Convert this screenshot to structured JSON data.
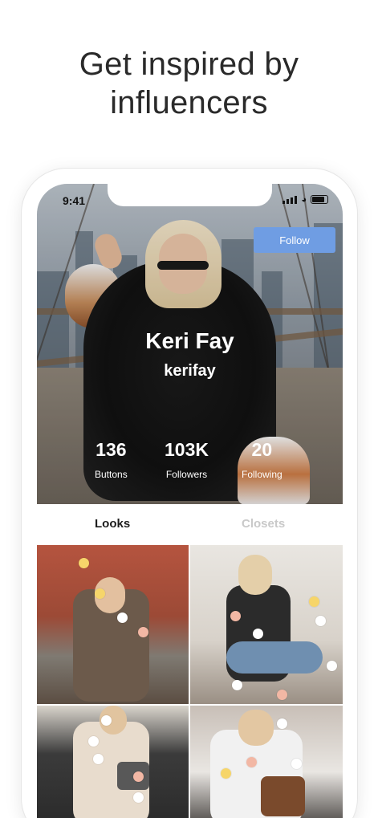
{
  "headline": "Get inspired by influencers",
  "status_bar": {
    "time": "9:41"
  },
  "profile": {
    "name": "Keri Fay",
    "handle": "kerifay",
    "follow_label": "Follow",
    "stats": [
      {
        "value": "136",
        "label": "Buttons"
      },
      {
        "value": "103K",
        "label": "Followers"
      },
      {
        "value": "20",
        "label": "Following"
      }
    ]
  },
  "tabs": [
    {
      "label": "Looks",
      "active": true
    },
    {
      "label": "Closets",
      "active": false
    }
  ],
  "grid": {
    "items": [
      {
        "name": "look-coffee-cafe",
        "dots": [
          "yellow",
          "yellow",
          "white",
          "peach"
        ]
      },
      {
        "name": "look-bedroom-mirror",
        "dots": [
          "peach",
          "yellow",
          "white",
          "white",
          "white",
          "peach"
        ]
      },
      {
        "name": "look-street-coat",
        "dots": [
          "white",
          "white",
          "white",
          "peach",
          "white"
        ]
      },
      {
        "name": "look-white-coat",
        "dots": [
          "white",
          "peach",
          "yellow",
          "white"
        ]
      }
    ]
  },
  "colors": {
    "follow_button": "#6f9de3",
    "tab_active": "#1d1d1d",
    "tab_inactive": "#c9c9c9",
    "dot_peach": "#f2b7a4",
    "dot_yellow": "#f6d56a"
  }
}
